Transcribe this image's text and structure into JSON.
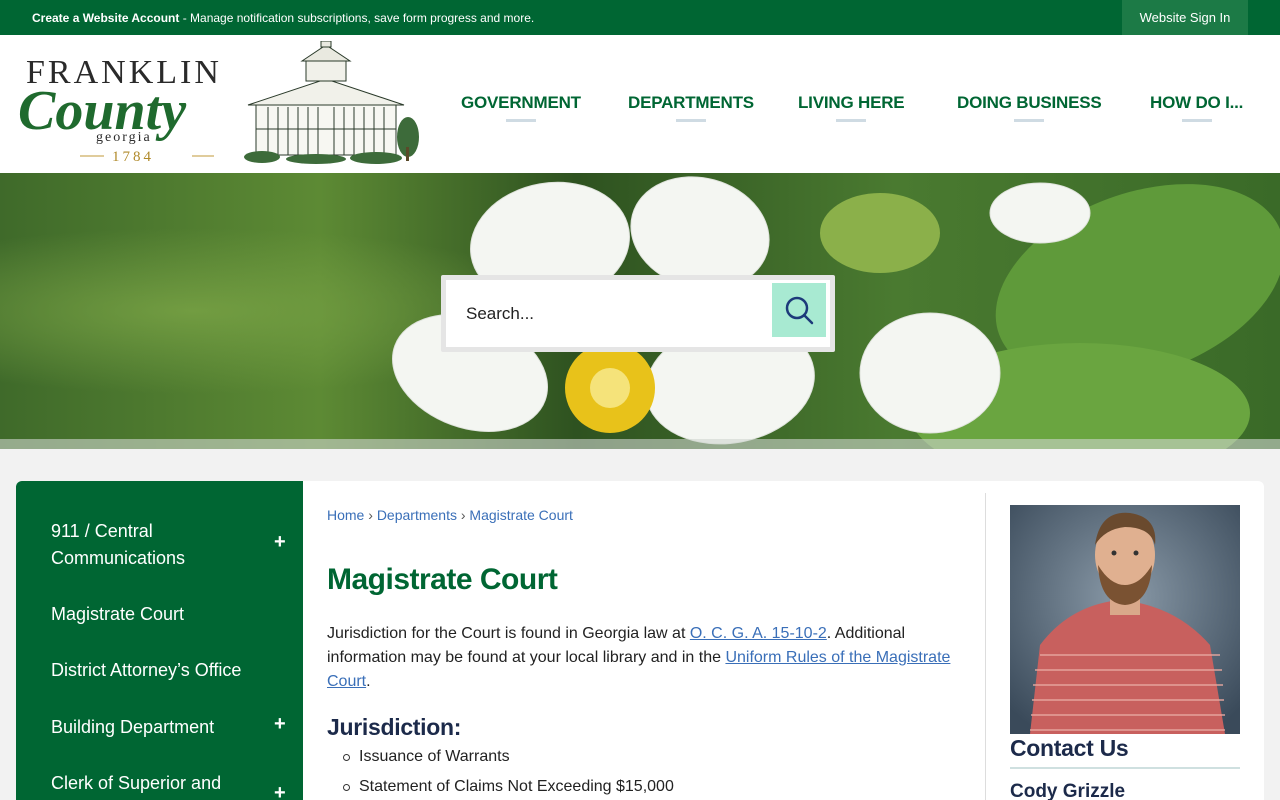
{
  "topbar": {
    "create_account_label": "Create a Website Account",
    "create_account_desc": " - Manage notification subscriptions, save form progress and more.",
    "sign_in_label": "Website Sign In"
  },
  "logo": {
    "line1": "FRANKLIN",
    "line2": "County",
    "line3": "georgia",
    "line4": "1784"
  },
  "nav": {
    "items": [
      {
        "label": "GOVERNMENT"
      },
      {
        "label": "DEPARTMENTS"
      },
      {
        "label": "LIVING HERE"
      },
      {
        "label": "DOING BUSINESS"
      },
      {
        "label": "HOW DO I..."
      }
    ]
  },
  "search": {
    "placeholder": "Search...",
    "icon": "search-icon"
  },
  "sidebar": {
    "items": [
      {
        "label": "911 / Central Communications",
        "expandable": true
      },
      {
        "label": "Magistrate Court",
        "expandable": false
      },
      {
        "label": "District Attorney’s Office",
        "expandable": false
      },
      {
        "label": "Building Department",
        "expandable": true
      },
      {
        "label": "Clerk of Superior and",
        "expandable": true
      }
    ],
    "expand_symbol": "+"
  },
  "breadcrumb": {
    "items": [
      "Home",
      "Departments",
      "Magistrate Court"
    ],
    "separator": "›"
  },
  "main": {
    "title": "Magistrate Court",
    "intro_part1": "Jurisdiction for the Court is found in Georgia law at ",
    "intro_link1": "O. C. G. A. 15-10-2",
    "intro_part2": ". Additional information may be found at your local library and in the ",
    "intro_link2": "Uniform Rules of the Magistrate Court",
    "intro_part3": ".",
    "jurisdiction_heading": "Jurisdiction:",
    "jurisdiction_items": [
      "Issuance of Warrants",
      "Statement of Claims Not Exceeding $15,000"
    ]
  },
  "contact": {
    "heading": "Contact Us",
    "name": "Cody Grizzle"
  },
  "colors": {
    "brand_green": "#006633",
    "link_blue": "#3a6fb8",
    "search_button": "#a8ead2",
    "heading_navy": "#1c2a4a"
  }
}
